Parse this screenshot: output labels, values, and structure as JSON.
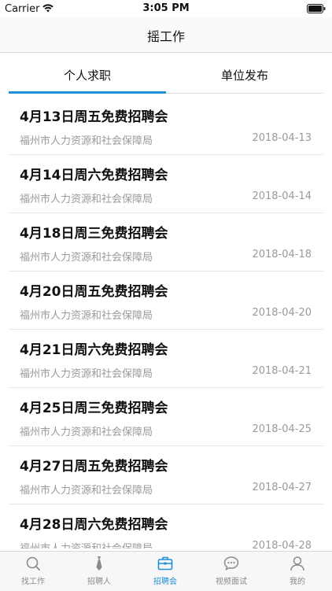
{
  "status": {
    "carrier": "Carrier",
    "time": "3:05 PM"
  },
  "nav": {
    "title": "摇工作"
  },
  "tabs": [
    {
      "label": "个人求职",
      "active": true
    },
    {
      "label": "单位发布",
      "active": false
    }
  ],
  "items": [
    {
      "title": "4月13日周五免费招聘会",
      "org": "福州市人力资源和社会保障局",
      "date": "2018-04-13"
    },
    {
      "title": "4月14日周六免费招聘会",
      "org": "福州市人力资源和社会保障局",
      "date": "2018-04-14"
    },
    {
      "title": "4月18日周三免费招聘会",
      "org": "福州市人力资源和社会保障局",
      "date": "2018-04-18"
    },
    {
      "title": "4月20日周五免费招聘会",
      "org": "福州市人力资源和社会保障局",
      "date": "2018-04-20"
    },
    {
      "title": "4月21日周六免费招聘会",
      "org": "福州市人力资源和社会保障局",
      "date": "2018-04-21"
    },
    {
      "title": "4月25日周三免费招聘会",
      "org": "福州市人力资源和社会保障局",
      "date": "2018-04-25"
    },
    {
      "title": "4月27日周五免费招聘会",
      "org": "福州市人力资源和社会保障局",
      "date": "2018-04-27"
    },
    {
      "title": "4月28日周六免费招聘会",
      "org": "福州市人力资源和社会保障局",
      "date": "2018-04-28"
    }
  ],
  "tabbar": [
    {
      "label": "找工作",
      "icon": "search-icon",
      "active": false
    },
    {
      "label": "招聘人",
      "icon": "tie-icon",
      "active": false
    },
    {
      "label": "招聘会",
      "icon": "briefcase-icon",
      "active": true
    },
    {
      "label": "视频面试",
      "icon": "chat-bubble-icon",
      "active": false
    },
    {
      "label": "我的",
      "icon": "user-icon",
      "active": false
    }
  ],
  "colors": {
    "accent": "#1f8fd6",
    "muted": "#9a9a9a",
    "inactive_icon": "#8a8a8a"
  }
}
